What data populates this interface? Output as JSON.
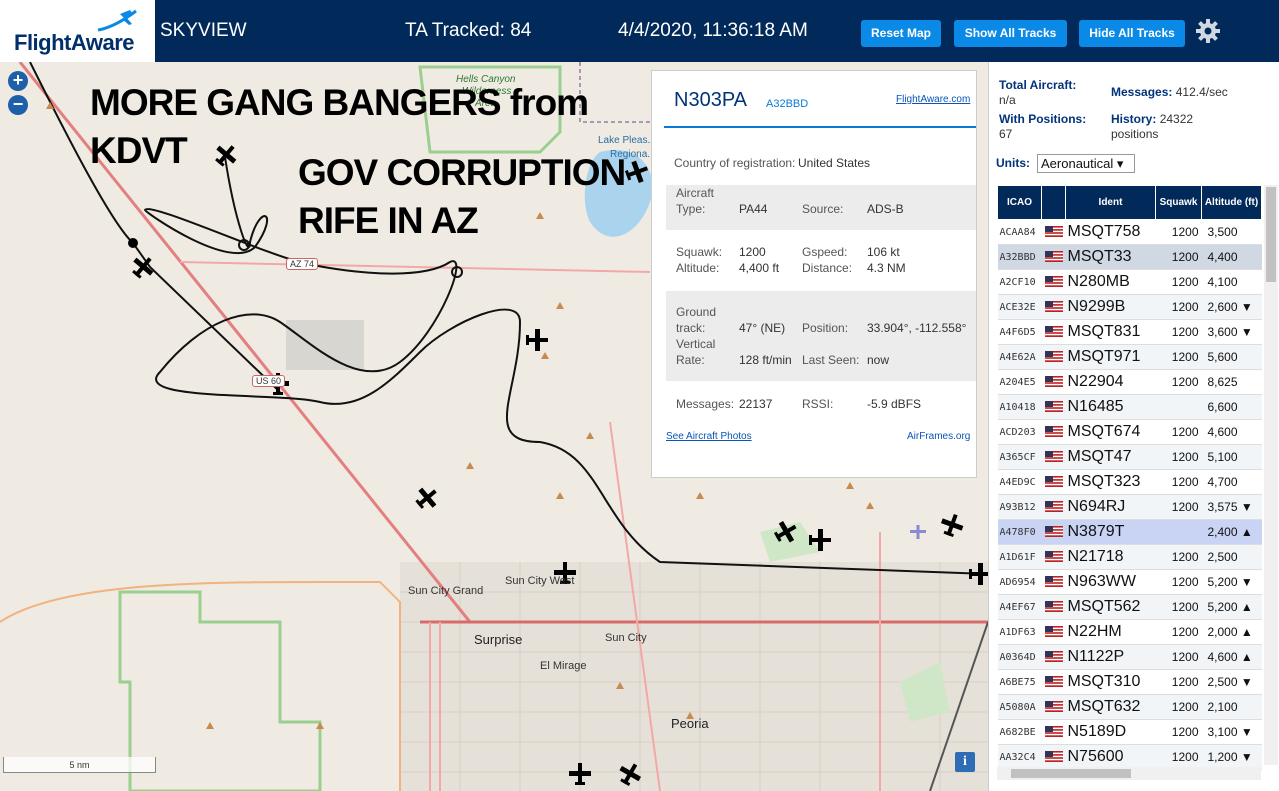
{
  "header": {
    "logo_text": "FlightAware",
    "app_title": "SKYVIEW",
    "tracked": "TA Tracked: 84",
    "datetime": "4/4/2020, 11:36:18 AM",
    "btn_reset": "Reset Map",
    "btn_show": "Show All Tracks",
    "btn_hide": "Hide All Tracks",
    "settings_icon": "gear-icon"
  },
  "map": {
    "zoom_in": "+",
    "zoom_out": "−",
    "annotations": [
      "MORE GANG BANGERS from",
      "KDVT",
      "GOV CORRUPTION",
      "RIFE IN AZ"
    ],
    "labels": {
      "hells_canyon": "Hells Canyon",
      "wilderness": "Wilderness",
      "area": "Area",
      "lake": "Lake Pleas...",
      "regional": "Regiona...",
      "sun_city_west": "Sun City West",
      "sun_city_grand": "Sun City Grand",
      "surprise": "Surprise",
      "sun_city": "Sun City",
      "el_mirage": "El Mirage",
      "peoria": "Peoria",
      "az74": "AZ 74",
      "us60": "US 60"
    },
    "scale": "5 nm",
    "info": "i"
  },
  "popup": {
    "callsign": "N303PA",
    "icao": "A32BBD",
    "fa_link": "FlightAware.com",
    "country_label": "Country of registration:",
    "country": "United States",
    "aircraft_type_label1": "Aircraft",
    "aircraft_type_label2": "Type:",
    "aircraft_type": "PA44",
    "source_label": "Source:",
    "source": "ADS-B",
    "squawk_label": "Squawk:",
    "squawk": "1200",
    "gspeed_label": "Gspeed:",
    "gspeed": "106 kt",
    "altitude_label": "Altitude:",
    "altitude": "4,400 ft",
    "distance_label": "Distance:",
    "distance": "4.3 NM",
    "ground_label1": "Ground",
    "ground_label2": "track:",
    "ground_track": "47° (NE)",
    "position_label": "Position:",
    "position": "33.904°, -112.558°",
    "vert_label1": "Vertical",
    "vert_label2": "Rate:",
    "vertical_rate": "128 ft/min",
    "last_seen_label": "Last Seen:",
    "last_seen": "now",
    "messages_label": "Messages:",
    "messages": "22137",
    "rssi_label": "RSSI:",
    "rssi": "-5.9 dBFS",
    "photos_link": "See Aircraft Photos",
    "airframes_link": "AirFrames.org"
  },
  "sidebar": {
    "total_label": "Total Aircraft:",
    "total": "n/a",
    "messages_label": "Messages:",
    "messages": "412.4/sec",
    "with_pos_label": "With Positions:",
    "with_pos": "67",
    "history_label": "History:",
    "history": "24322 positions",
    "units_label": "Units:",
    "units_value": "Aeronautical ▾",
    "columns": [
      "ICAO",
      "",
      "Ident",
      "Squawk",
      "Altitude (ft)"
    ],
    "rows": [
      {
        "icao": "ACAA84",
        "ident": "MSQT758",
        "squawk": "1200",
        "alt": "3,500"
      },
      {
        "icao": "A32BBD",
        "ident": "MSQT33",
        "squawk": "1200",
        "alt": "4,400"
      },
      {
        "icao": "A2CF10",
        "ident": "N280MB",
        "squawk": "1200",
        "alt": "4,100"
      },
      {
        "icao": "ACE32E",
        "ident": "N9299B",
        "squawk": "1200",
        "alt": "2,600 ▼"
      },
      {
        "icao": "A4F6D5",
        "ident": "MSQT831",
        "squawk": "1200",
        "alt": "3,600 ▼"
      },
      {
        "icao": "A4E62A",
        "ident": "MSQT971",
        "squawk": "1200",
        "alt": "5,600"
      },
      {
        "icao": "A204E5",
        "ident": "N22904",
        "squawk": "1200",
        "alt": "8,625"
      },
      {
        "icao": "A10418",
        "ident": "N16485",
        "squawk": "",
        "alt": "6,600"
      },
      {
        "icao": "ACD203",
        "ident": "MSQT674",
        "squawk": "1200",
        "alt": "4,600"
      },
      {
        "icao": "A365CF",
        "ident": "MSQT47",
        "squawk": "1200",
        "alt": "5,100"
      },
      {
        "icao": "A4ED9C",
        "ident": "MSQT323",
        "squawk": "1200",
        "alt": "4,700"
      },
      {
        "icao": "A93B12",
        "ident": "N694RJ",
        "squawk": "1200",
        "alt": "3,575 ▼"
      },
      {
        "icao": "A478F0",
        "ident": "N3879T",
        "squawk": "",
        "alt": "2,400 ▲"
      },
      {
        "icao": "A1D61F",
        "ident": "N21718",
        "squawk": "1200",
        "alt": "2,500"
      },
      {
        "icao": "AD6954",
        "ident": "N963WW",
        "squawk": "1200",
        "alt": "5,200 ▼"
      },
      {
        "icao": "A4EF67",
        "ident": "MSQT562",
        "squawk": "1200",
        "alt": "5,200 ▲"
      },
      {
        "icao": "A1DF63",
        "ident": "N22HM",
        "squawk": "1200",
        "alt": "2,000 ▲"
      },
      {
        "icao": "A0364D",
        "ident": "N1122P",
        "squawk": "1200",
        "alt": "4,600 ▲"
      },
      {
        "icao": "A6BE75",
        "ident": "MSQT310",
        "squawk": "1200",
        "alt": "2,500 ▼"
      },
      {
        "icao": "A5080A",
        "ident": "MSQT632",
        "squawk": "1200",
        "alt": "2,100"
      },
      {
        "icao": "A682BE",
        "ident": "N5189D",
        "squawk": "1200",
        "alt": "3,100 ▼"
      },
      {
        "icao": "AA32C4",
        "ident": "N75600",
        "squawk": "1200",
        "alt": "1,200 ▼"
      }
    ],
    "highlight_row": 1,
    "selected_row": 12
  },
  "colors": {
    "header_bg": "#012a5a",
    "button_bg": "#0a8ae6",
    "accent": "#0a7ad6"
  }
}
